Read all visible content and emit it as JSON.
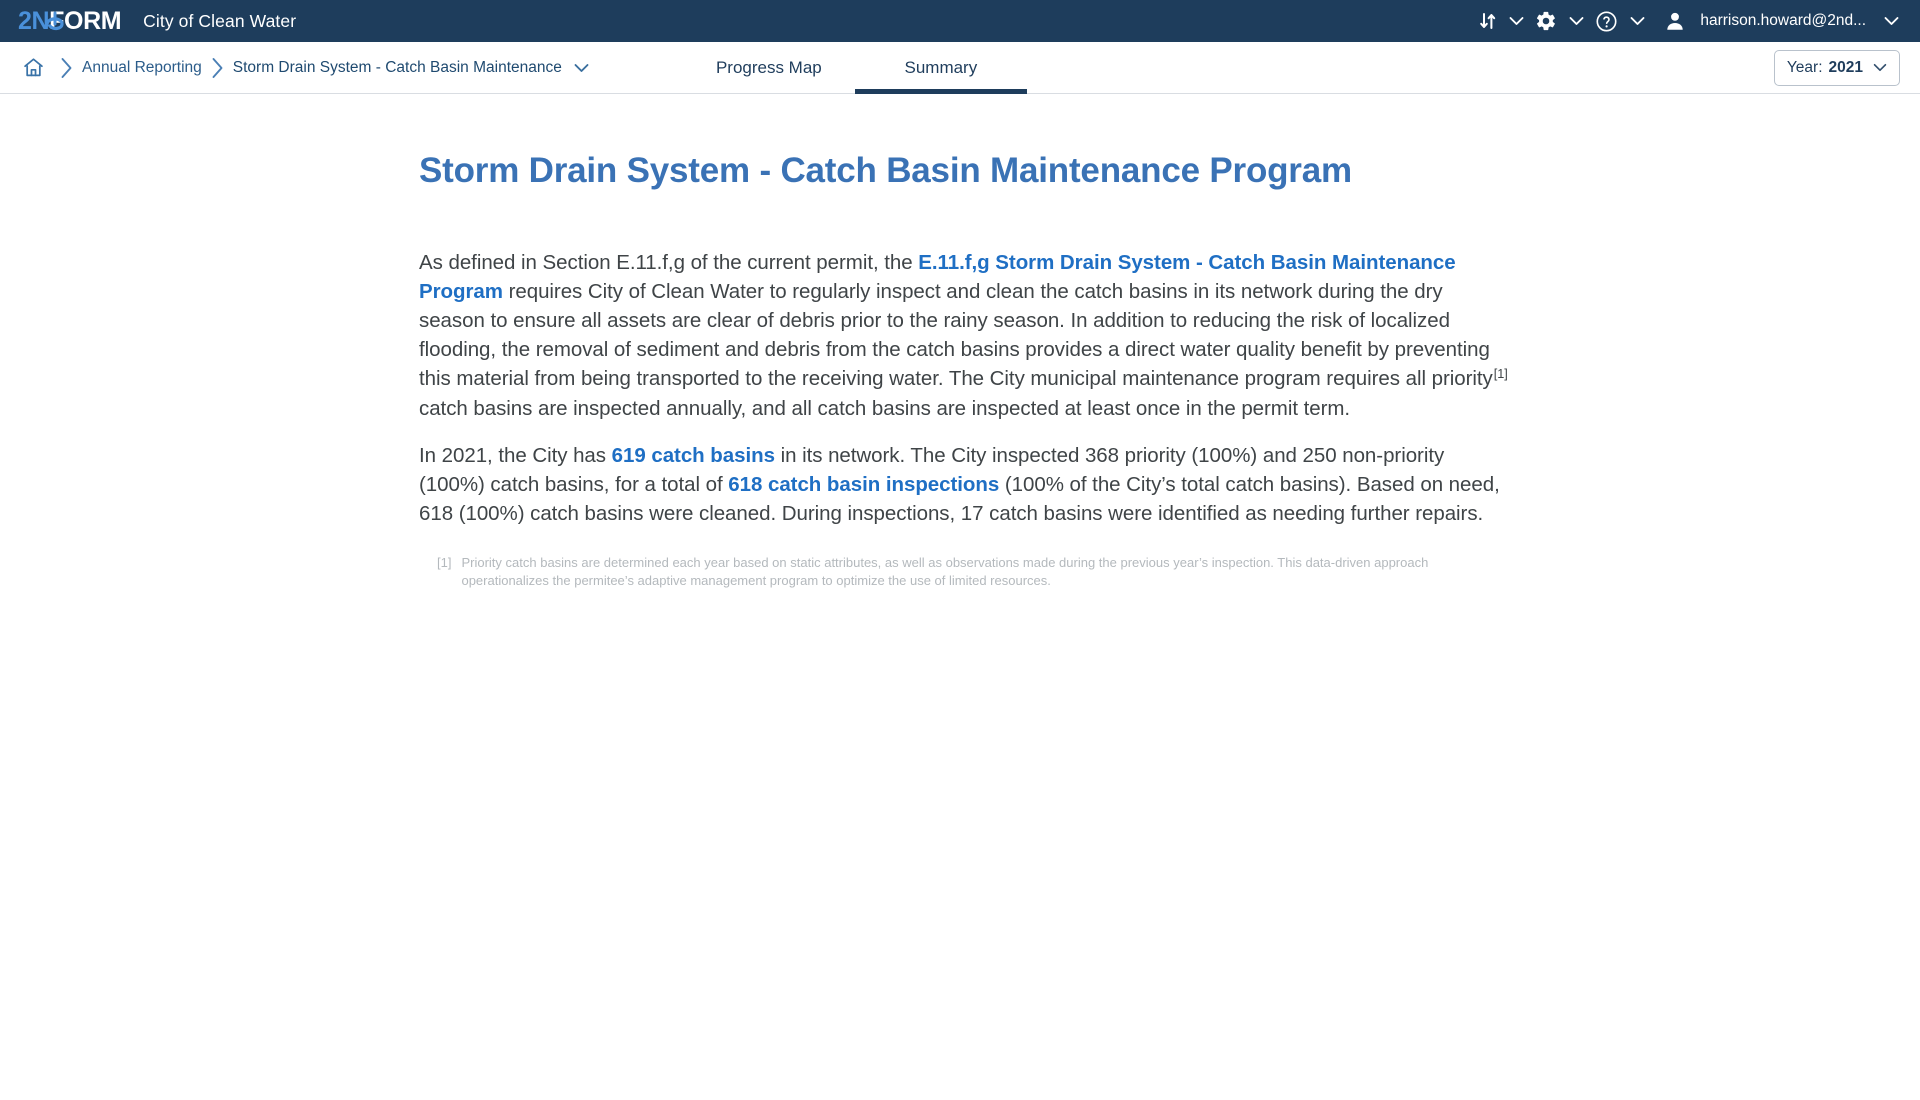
{
  "header": {
    "logo": {
      "part1": "2N",
      "part2": "FORM",
      "icon": "swirl-logo-icon"
    },
    "org_name": "City of Clean Water",
    "actions": [
      {
        "icon": "sort-arrows-icon",
        "name": "data-transfer-menu",
        "caret": true
      },
      {
        "icon": "gear-icon",
        "name": "settings-menu",
        "caret": true
      },
      {
        "icon": "question-circle-icon",
        "name": "help-menu",
        "caret": true
      }
    ],
    "user": {
      "avatar_icon": "person-avatar-icon",
      "label": "harrison.howard@2nd...",
      "caret_icon": "chevron-down-icon"
    }
  },
  "subbar": {
    "breadcrumb": {
      "home_icon": "home-icon",
      "separator_icon": "chevron-right-icon",
      "items": [
        {
          "label": "Annual Reporting"
        },
        {
          "label": "Storm Drain System - Catch Basin Maintenance"
        }
      ],
      "caret_icon": "chevron-down-icon"
    },
    "tabs": [
      {
        "label": "Progress Map",
        "active": false
      },
      {
        "label": "Summary",
        "active": true
      }
    ],
    "year_filter": {
      "prefix": "Year:",
      "value": "2021",
      "caret_icon": "chevron-down-icon"
    }
  },
  "main": {
    "title": "Storm Drain System - Catch Basin Maintenance Program",
    "paragraph1": {
      "seg1": "As defined in Section E.11.f,g of the current permit, the ",
      "link1": "E.11.f,g Storm Drain System - Catch Basin Maintenance Program",
      "seg2": " requires City of Clean Water to regularly inspect and clean the catch basins in its network during the dry season to ensure all assets are clear of debris prior to the rainy season. In addition to reducing the risk of localized flooding, the removal of sediment and debris from the catch basins provides a direct water quality benefit by preventing this material from being transported to the receiving water. The City municipal maintenance program requires all priority",
      "footnote_marker": "[1]",
      "seg3": " catch basins are inspected annually, and all catch basins are inspected at least once in the permit term."
    },
    "paragraph2": {
      "seg1": "In 2021, the City has ",
      "link1": "619 catch basins",
      "seg2": " in its network. The City inspected 368 priority (100%) and 250 non-priority (100%) catch basins, for a total of ",
      "link2": "618 catch basin inspections",
      "seg3": " (100% of the City’s total catch basins). Based on need, 618 (100%) catch basins were cleaned. During inspections, 17 catch basins were identified as needing further repairs."
    },
    "footnotes": [
      {
        "mark": "[1]",
        "text": "Priority catch basins are determined each year based on static attributes, as well as observations made during the previous year’s inspection. This data-driven approach operationalizes the permitee’s adaptive management program to optimize the use of limited resources."
      }
    ]
  },
  "colors": {
    "header_bg": "#1e3d5c",
    "logo_accent": "#4a90d9",
    "title_blue": "#3a72b5",
    "link_blue": "#1f6fc4",
    "body_text": "#3f4447",
    "footnote_text": "#b4b9bd",
    "tab_underline": "#1e3d5c"
  }
}
